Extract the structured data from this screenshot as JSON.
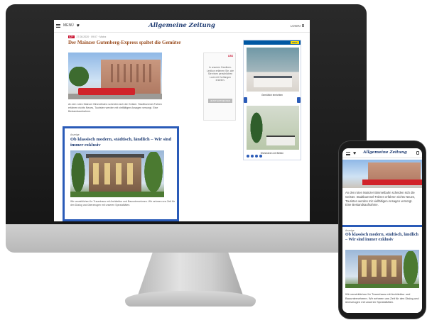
{
  "desktop": {
    "menu_label": "MENÜ",
    "masthead": "Allgemeine Zeitung",
    "login_label": "LOGIN",
    "article": {
      "meta_tag": "AZ+",
      "meta_text": "27.08.2020 · 09:07 · Mainz",
      "headline": "Der Mainzer Gutenberg-Express spaltet die Gemüter",
      "caption": "An den roten Mainzer Bimmelbahn scheiden sich die Geister. Stadtbummel-Fahren erfahren nichts Neues, Touristen werden mit vielfältigen Ansagen versorgt. Eine Bestandsaufnahme."
    },
    "sponsored": {
      "label": "Anzeige",
      "headline": "Ob klassisch modern, städtisch, ländlich – Wir sind immer exklusiv",
      "text": "Wir verwirklichen Ihr Traumhaus mit Architektur und Bauunternehmen. Wir nehmen uns Zeit für den Dialog und überzeugen mit unseren Spezialitäten."
    },
    "side_ad": {
      "logo": "LBS",
      "text": "In unseren Gardinen-Lexikon erfahren Sie, wie Sie einen persönlichen Look mit Vorhängen erzielen.",
      "button": "JETZT ENTDECKEN"
    },
    "furniture_ad": {
      "brand": "IKEA",
      "caption_1": "Gemütlich einrichten",
      "caption_2": "Wohnideen mit Betten"
    }
  },
  "phone": {
    "masthead": "Allgemeine Zeitung",
    "caption": "An den roten Mainzer Bimmelbahn scheiden sich die Geister. Stadtbummel-Fahren erfahren nichts Neues, Touristen werden mit vielfältigen Ansagen versorgt. Eine Bestandsaufnahme.",
    "sponsored": {
      "label": "Anzeige",
      "headline": "Ob klassisch modern, städtisch, ländlich – Wir sind immer exklusiv",
      "text": "Wir verwirklichen Ihr Traumhaus mit Architektur und Bauunternehmen. Wir nehmen uns Zeit für den Dialog und überzeugen mit unseren Spezialitäten."
    }
  },
  "colors": {
    "accent_blue": "#2a5bb8",
    "masthead_blue": "#1f3c73",
    "headline_brown": "#9a4d1f",
    "badge_red": "#c8102e"
  }
}
